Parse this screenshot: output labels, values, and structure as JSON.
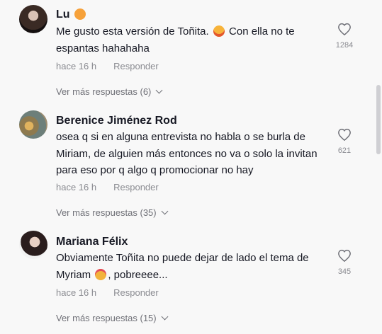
{
  "comments": [
    {
      "username": "Lu",
      "text_before_emoji": "Me gusto esta versión de Toñita. ",
      "text_after_emoji": " Con ella no te espantas hahahaha",
      "time": "hace 16 h",
      "reply_label": "Responder",
      "more_replies": "Ver más respuestas (6)",
      "likes": "1284"
    },
    {
      "username": "Berenice Jiménez Rod",
      "text": "osea q si en alguna entrevista no habla o se burla de Miriam, de alguien más entonces no va o solo la invitan para eso por q algo q promocionar no hay",
      "time": "hace 16 h",
      "reply_label": "Responder",
      "more_replies": "Ver más respuestas (35)",
      "likes": "621"
    },
    {
      "username": "Mariana Félix",
      "text_before_emoji": "Obviamente Toñita no puede dejar de lado el tema de Myriam ",
      "text_after_emoji": ", pobreeee...",
      "time": "hace 16 h",
      "reply_label": "Responder",
      "more_replies": "Ver más respuestas (15)",
      "likes": "345"
    }
  ]
}
